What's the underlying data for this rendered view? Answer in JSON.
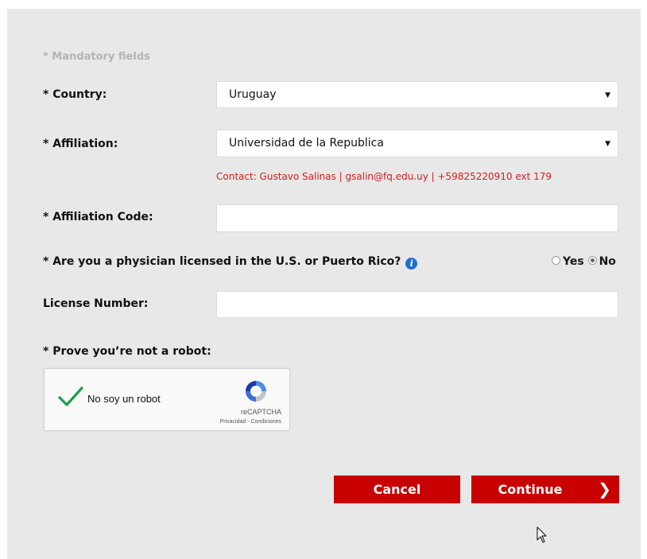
{
  "form": {
    "mandatory_note": "* Mandatory fields",
    "country": {
      "label": "* Country:",
      "value": "Uruguay"
    },
    "affiliation": {
      "label": "* Affiliation:",
      "value": "Universidad de la Republica",
      "contact": "Contact: Gustavo Salinas | gsalin@fq.edu.uy | +59825220910 ext 179"
    },
    "affiliation_code": {
      "label": "* Affiliation Code:",
      "value": ""
    },
    "physician": {
      "label": "* Are you a physician licensed in the U.S. or Puerto Rico?",
      "info_icon": "info-icon",
      "options": [
        {
          "label": "Yes",
          "selected": false
        },
        {
          "label": "No",
          "selected": true
        }
      ]
    },
    "license_number": {
      "label": "License Number:",
      "value": ""
    },
    "robot": {
      "label": "* Prove you’re not a robot:"
    }
  },
  "captcha": {
    "label": "No soy un robot",
    "brand": "reCAPTCHA",
    "links": "Privacidad - Condiciones",
    "checked": true
  },
  "actions": {
    "cancel_label": "Cancel",
    "continue_label": "Continue",
    "continue_icon": "❯"
  },
  "colors": {
    "panel_bg": "#e8e8e8",
    "accent": "#c80000",
    "contact_text": "#cc1f1f",
    "info_icon": "#1f6fd1",
    "check_green": "#1e9e4a"
  }
}
